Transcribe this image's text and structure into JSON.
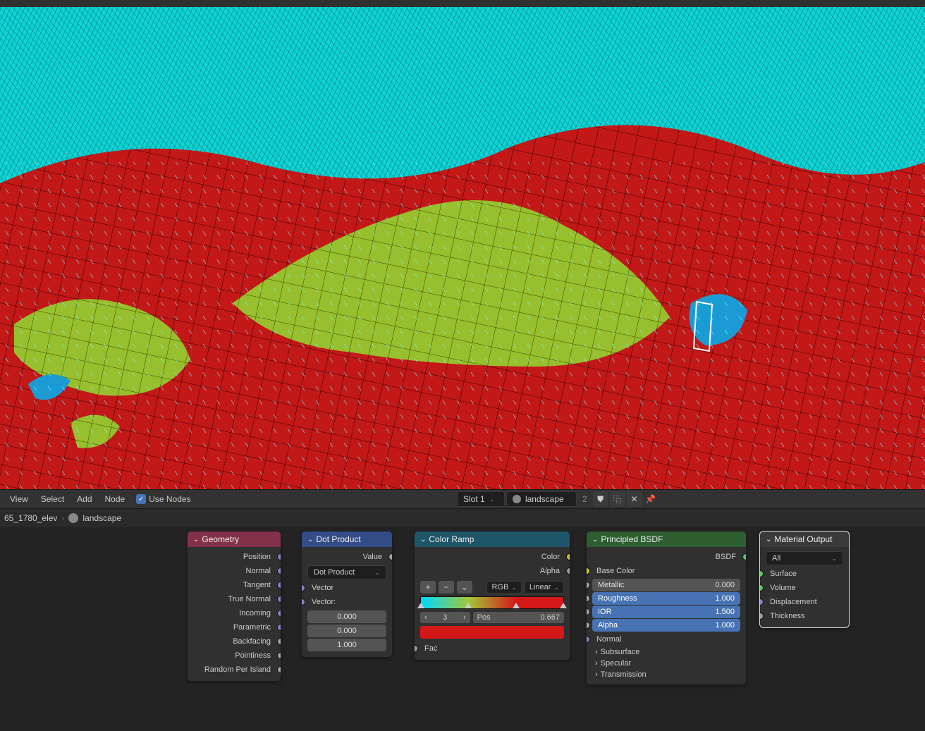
{
  "menus": {
    "view": "View",
    "select": "Select",
    "add": "Add",
    "node": "Node",
    "use_nodes": "Use Nodes"
  },
  "slot": {
    "label": "Slot 1"
  },
  "material": {
    "name": "landscape",
    "count": "2"
  },
  "breadcrumb": {
    "object": "65_1780_elev",
    "mat": "landscape"
  },
  "geometry": {
    "title": "Geometry",
    "outputs": [
      "Position",
      "Normal",
      "Tangent",
      "True Normal",
      "Incoming",
      "Parametric",
      "Backfacing",
      "Pointiness",
      "Random Per Island"
    ]
  },
  "dot": {
    "title": "Dot Product",
    "value": "Value",
    "op": "Dot Product",
    "vector": "Vector",
    "vector2": "Vector:",
    "x": "0.000",
    "y": "0.000",
    "z": "1.000"
  },
  "ramp": {
    "title": "Color Ramp",
    "color": "Color",
    "alpha": "Alpha",
    "mode": "RGB",
    "interp": "Linear",
    "idx_label": "",
    "idx": "3",
    "pos_label": "Pos",
    "pos": "0.667",
    "fac": "Fac",
    "stops": [
      {
        "pos": 0.0,
        "color": "#00d9ff"
      },
      {
        "pos": 0.333,
        "color": "#a2c93a"
      },
      {
        "pos": 0.667,
        "color": "#d41818"
      },
      {
        "pos": 1.0,
        "color": "#d41818"
      }
    ],
    "sel_color": "#d41818"
  },
  "bsdf": {
    "title": "Principled BSDF",
    "out": "BSDF",
    "base": "Base Color",
    "metallic": {
      "l": "Metallic",
      "v": "0.000"
    },
    "roughness": {
      "l": "Roughness",
      "v": "1.000"
    },
    "ior": {
      "l": "IOR",
      "v": "1.500"
    },
    "alpha": {
      "l": "Alpha",
      "v": "1.000"
    },
    "normal": "Normal",
    "panels": [
      "Subsurface",
      "Specular",
      "Transmission"
    ]
  },
  "out": {
    "title": "Material Output",
    "target": "All",
    "inputs": [
      "Surface",
      "Volume",
      "Displacement",
      "Thickness"
    ]
  }
}
